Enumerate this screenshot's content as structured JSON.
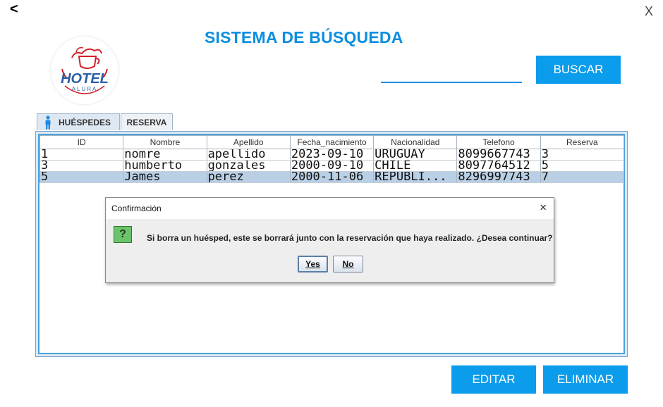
{
  "window": {
    "back_label": "<",
    "close_label": "X"
  },
  "page": {
    "title": "SISTEMA DE BÚSQUEDA"
  },
  "logo": {
    "line1": "HOTEL",
    "line2": "ALURA",
    "icon": "coffee-cup-logo"
  },
  "search": {
    "value": "",
    "button_label": "BUSCAR"
  },
  "tabs": [
    {
      "label": "HUÉSPEDES",
      "icon": "person-icon",
      "selected": true
    },
    {
      "label": "RESERVA",
      "selected": false
    }
  ],
  "table": {
    "columns": [
      "ID",
      "Nombre",
      "Apellido",
      "Fecha_nacimiento",
      "Nacionalidad",
      "Telefono",
      "Reserva"
    ],
    "rows": [
      [
        "1",
        "nomre",
        "apellido",
        "2023-09-10",
        "URUGUAY",
        "8099667743",
        "3"
      ],
      [
        "3",
        "humberto",
        "gonzales",
        "2000-09-10",
        "CHILE",
        "8097764512",
        "5"
      ],
      [
        "5",
        "James",
        "perez",
        "2000-11-06",
        "REPUBLI...",
        "8296997743",
        "7"
      ]
    ],
    "selected_row": 2
  },
  "dialog": {
    "title": "Confirmación",
    "close_label": "×",
    "icon": "question-icon",
    "icon_glyph": "?",
    "message": "Si borra un huésped, este se borrará junto con la reservación que haya realizado. ¿Desea continuar?",
    "yes_label": "Yes",
    "no_label": "No"
  },
  "actions": {
    "edit_label": "EDITAR",
    "delete_label": "ELIMINAR"
  },
  "colors": {
    "accent": "#0b9cec",
    "title": "#0d8ee0",
    "selection": "#b8cfe5"
  }
}
